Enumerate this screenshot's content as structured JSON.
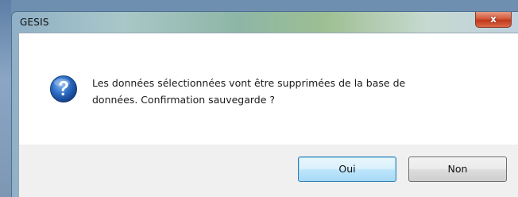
{
  "window": {
    "title": "GESIS",
    "close_glyph": "x"
  },
  "message": {
    "icon": "question-icon",
    "text": "Les données  sélectionnées vont être supprimées de  la base de\ndonnées.  Confirmation sauvegarde ?"
  },
  "buttons": {
    "yes_label": "Oui",
    "no_label": "Non"
  },
  "colors": {
    "icon_blue": "#1f5fb0",
    "default_button_border": "#3c7fb1",
    "close_button": "#c9462a"
  }
}
